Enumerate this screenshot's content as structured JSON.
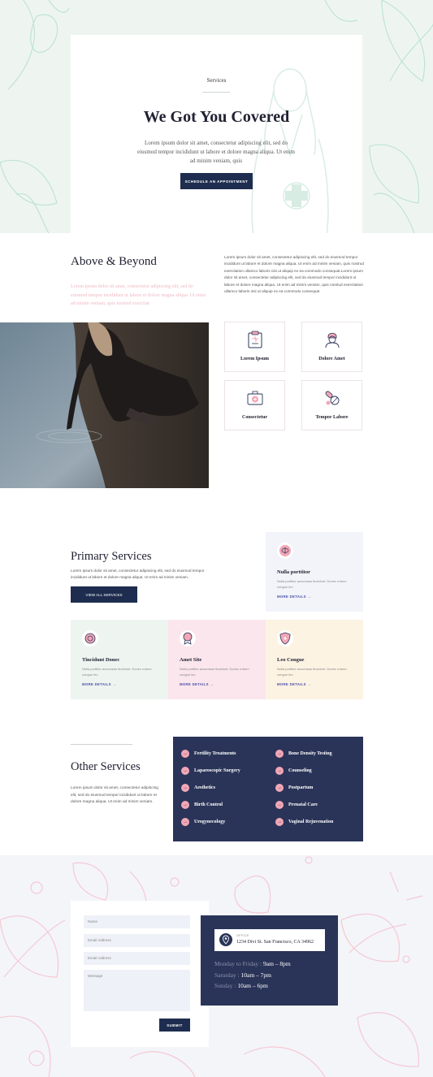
{
  "colors": {
    "navy": "#1e2d4f",
    "panel_navy": "#2a3458",
    "hero_bg": "#eef5f1",
    "pink": "#f2a7b6",
    "mint_card": "#eef5f1",
    "pink_card": "#fae6ec",
    "cream_card": "#fdf3e3",
    "light_card": "#f2f4f9",
    "link_purple": "#4b4fa8"
  },
  "hero": {
    "eyebrow": "Services",
    "title": "We Got You Covered",
    "text": "Lorem ipsum dolor sit amet, consectetur adipiscing elit, sed do eiusmod tempor incididunt ut labore et dolore magna aliqua. Ut enim ad minim veniam, quis",
    "cta": "SCHEDULE AN APPOINTMENT"
  },
  "above": {
    "title": "Above & Beyond",
    "pink_text": "Lorem ipsum dolor sit amet, consectetur adipiscing elit, sed do eiusmod tempor incididunt ut labore et dolore magna aliqua. Ut enim ad minim veniam, quis nostrud exercitat",
    "right_text": "Lorem ipsum dolor sit amet, consectetur adipiscing elit, sed do eiusmod tempor incididunt ut labore et dolore magna aliqua. Ut enim ad minim veniam, quis nostrud exercitation ullamco laboris nisi ut aliquip ex ea commodo consequat.Lorem ipsum dolor sit amet, consectetur adipiscing elit, sed do eiusmod tempor incididunt ut labore et dolore magna aliqua. Ut enim ad minim veniam, quis nostrud exercitation ullamco laboris nisi ut aliquip ex ea commodo consequat",
    "features": [
      {
        "label": "Lorem Ipsum",
        "icon": "clipboard-icon"
      },
      {
        "label": "Dolore Amet",
        "icon": "nurse-icon"
      },
      {
        "label": "Consectetur",
        "icon": "medkit-icon"
      },
      {
        "label": "Tempor Labore",
        "icon": "pills-icon"
      }
    ]
  },
  "primary": {
    "title": "Primary Services",
    "text": "Lorem ipsum dolor sit amet, consectetur adipiscing elit, sed do eiusmod tempor incididunt ut labore et dolore magna aliqua. Ut enim ad minim veniam.",
    "cta": "VIEW ALL SERVICES",
    "cards": [
      {
        "title": "Nulla porttitor",
        "text": "Nulla porttitor accumsan tincidunt. Donec rutrum congue leo",
        "link": "MORE DETAILS →",
        "icon": "brain-icon"
      },
      {
        "title": "Tincidunt Donec",
        "text": "Nulla porttitor accumsan tincidunt. Donec rutrum congue leo",
        "link": "MORE DETAILS →",
        "icon": "circle-badge-icon"
      },
      {
        "title": "Amet Site",
        "text": "Nulla porttitor accumsan tincidunt. Donec rutrum congue leo",
        "link": "MORE DETAILS →",
        "icon": "award-icon"
      },
      {
        "title": "Leo Congue",
        "text": "Nulla porttitor accumsan tincidunt. Donec rutrum congue leo",
        "link": "MORE DETAILS →",
        "icon": "shield-icon"
      }
    ]
  },
  "other": {
    "title": "Other Services",
    "text": "Lorem ipsum dolor sit amet, consectetur adipiscing elit, sed do eiusmod tempor incididunt ut labore et dolore magna aliqua. Ut enim ad minim veniam.",
    "left_items": [
      "Fertility Treatments",
      "Laparoscopic Surgery",
      "Aesthetics",
      "Birth Control",
      "Urogynecology"
    ],
    "right_items": [
      "Bone Density Testing",
      "Counseling",
      "Postpartum",
      "Prenatal Care",
      "Vaginal Rejuvenation"
    ],
    "bullet": "→"
  },
  "contact": {
    "name_placeholder": "Name",
    "email_placeholder": "Email Address",
    "email2_placeholder": "Email Address",
    "message_placeholder": "Message",
    "submit": "SUBMIT",
    "address_label": "OFFICE",
    "address": "1234 Divi St. San Francisco, CA 34962",
    "hours": [
      {
        "day": "Monday to Friday",
        "time": "9am – 8pm"
      },
      {
        "day": "Saturday",
        "time": "10am – 7pm"
      },
      {
        "day": "Sunday",
        "time": "10am – 6pm"
      }
    ]
  }
}
